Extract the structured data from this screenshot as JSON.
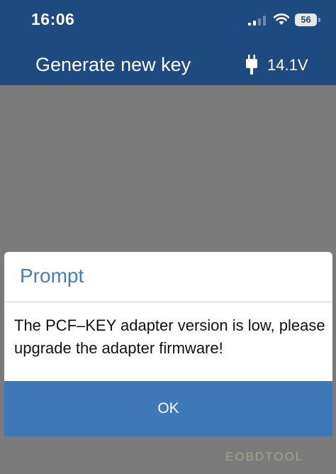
{
  "status_bar": {
    "time": "16:06",
    "battery_level": "56",
    "signal_icon": "cellular-signal-icon",
    "wifi_icon": "wifi-icon",
    "battery_icon": "battery-icon"
  },
  "nav_bar": {
    "title": "Generate new key",
    "plug_icon": "usb-plug-icon",
    "voltage": "14.1V"
  },
  "dialog": {
    "title": "Prompt",
    "message": "The PCF–KEY adapter version is low, please upgrade the adapter firmware!",
    "ok_label": "OK"
  },
  "watermark": {
    "text": "EOBDTOOL"
  },
  "colors": {
    "header_bg": "#1d4a7f",
    "overlay_bg": "#7b7b7b",
    "dialog_title": "#4a7dbd",
    "ok_button_bg": "#3f78b9"
  }
}
